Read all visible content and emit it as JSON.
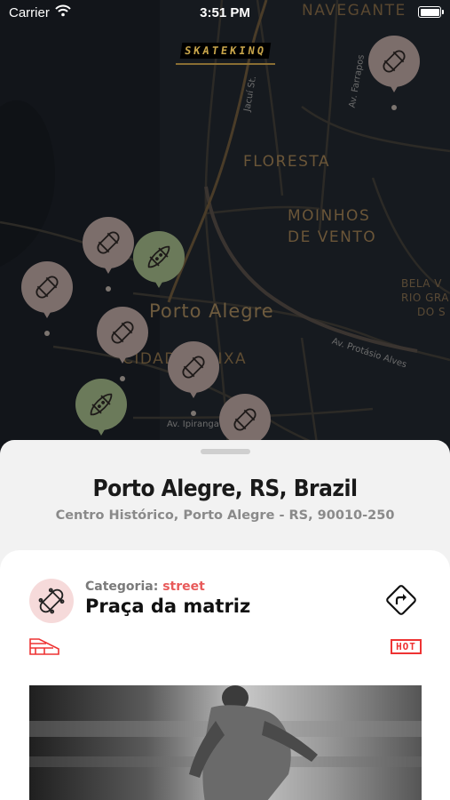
{
  "status_bar": {
    "carrier": "Carrier",
    "time": "3:51 PM"
  },
  "app": {
    "logo_text": "SKATEKINQ"
  },
  "map": {
    "labels": {
      "navegantes": "NAVEGANTE",
      "floresta": "FLORESTA",
      "moinhos_1": "MOINHOS",
      "moinhos_2": "DE VENTO",
      "bela_1": "BELA V",
      "bela_2": "RIO GRA",
      "bela_3": "DO S",
      "city": "Porto Alegre",
      "cidade_baixa": "CIDADE BAIXA",
      "av_protasio": "Av. Protásio Alves",
      "av_ipiranga": "Av. Ipiranga",
      "av_farrapos": "Av. Farrapos",
      "jacui": "Jacuí St."
    },
    "pins": [
      {
        "category": "street",
        "color": "gray"
      },
      {
        "category": "street",
        "color": "gray"
      },
      {
        "category": "longboard",
        "color": "green"
      },
      {
        "category": "street",
        "color": "gray"
      },
      {
        "category": "street",
        "color": "gray"
      },
      {
        "category": "street",
        "color": "gray"
      },
      {
        "category": "longboard",
        "color": "green"
      },
      {
        "category": "street",
        "color": "gray"
      }
    ]
  },
  "sheet": {
    "title": "Porto Alegre, RS, Brazil",
    "subtitle": "Centro Histórico, Porto Alegre - RS, 90010-250"
  },
  "spot": {
    "category_label": "Categoria:",
    "category_value": "street",
    "name": "Praça da matriz",
    "badge": "HOT"
  },
  "colors": {
    "accent": "#e85a5a",
    "pin_gray": "#7c6e6b",
    "pin_green": "#6b7a5a",
    "map_bg": "#161a1f"
  },
  "icons": {
    "directions": "directions-icon",
    "ramp": "ramp-icon",
    "skateboard": "skateboard-icon",
    "longboard": "longboard-icon"
  }
}
